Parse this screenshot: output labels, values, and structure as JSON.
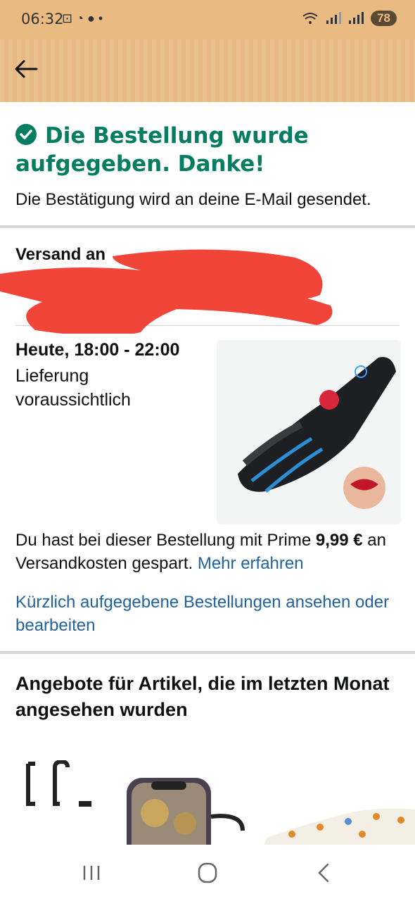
{
  "status_bar": {
    "time": "06:32",
    "left_icons": "⊡ ◔ ● •",
    "battery": "78"
  },
  "header": {
    "back_icon": "arrow-left-icon"
  },
  "confirmation": {
    "title": "Die Bestellung wurde aufgegeben. Danke!",
    "subtitle": "Die Bestätigung wird an deine E-Mail gesendet."
  },
  "shipping": {
    "title": "Versand an",
    "line2": "",
    "line3": ""
  },
  "delivery": {
    "date": "Heute, 18:00 - 22:00",
    "label": "Lieferung voraussichtlich"
  },
  "prime": {
    "text_before": "Du hast bei dieser Bestellung mit Prime ",
    "amount": "9,99 €",
    "text_after": " an Versandkosten gespart. ",
    "link": "Mehr erfahren"
  },
  "recent_orders_link": "Kürzlich aufgegebene Bestellungen ansehen oder bearbeiten",
  "offers": {
    "title": "Angebote für Artikel, die im letzten Monat angesehen wurden"
  },
  "colors": {
    "header_bg": "#e9bb82",
    "success_green": "#067d62",
    "link_blue": "#2162a1",
    "redaction_red": "#f04538"
  }
}
